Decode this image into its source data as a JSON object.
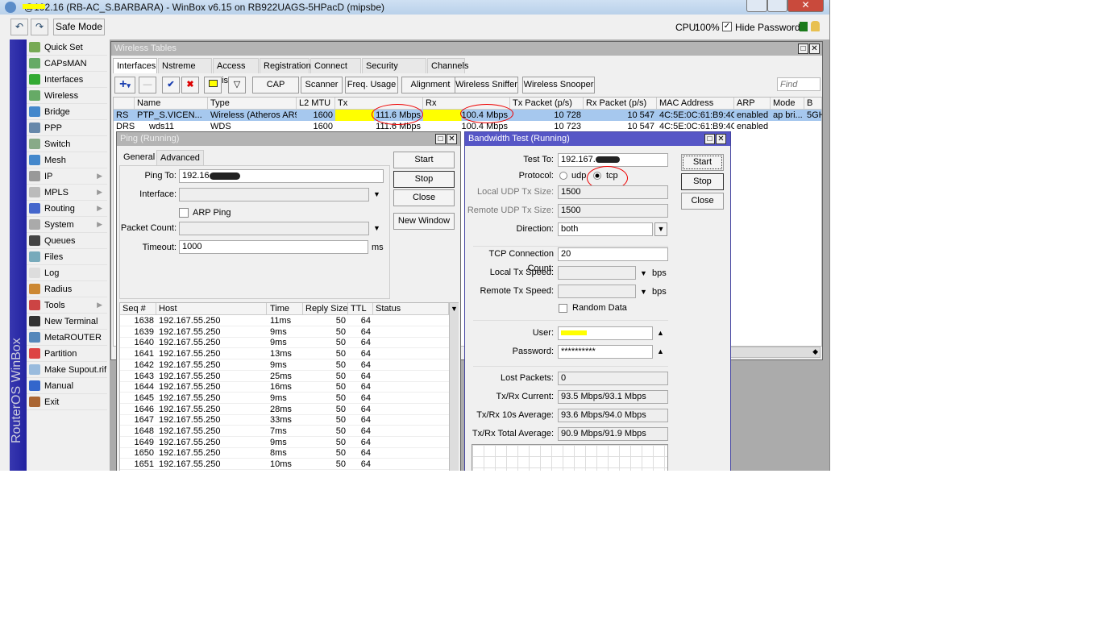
{
  "window": {
    "title": "@192.16 (RB-AC_S.BARBARA) - WinBox v6.15 on RB922UAGS-5HPacD (mipsbe)"
  },
  "toolbar": {
    "undo_icon": "undo-icon",
    "redo_icon": "redo-icon",
    "safe_mode": "Safe Mode",
    "cpu_label": "CPU:",
    "cpu_value": "100%",
    "hide_passwords": "Hide Passwords",
    "hide_passwords_checked": true
  },
  "sidebar": {
    "brand": "RouterOS WinBox",
    "items": [
      {
        "label": "Quick Set",
        "icon": "wand-icon",
        "color": "#7a5"
      },
      {
        "label": "CAPsMAN",
        "icon": "antenna-icon",
        "color": "#6a6"
      },
      {
        "label": "Interfaces",
        "icon": "interfaces-icon",
        "color": "#3a3"
      },
      {
        "label": "Wireless",
        "icon": "antenna-icon",
        "color": "#6a6"
      },
      {
        "label": "Bridge",
        "icon": "bridge-icon",
        "color": "#48c"
      },
      {
        "label": "PPP",
        "icon": "ppp-icon",
        "color": "#68a"
      },
      {
        "label": "Switch",
        "icon": "switch-icon",
        "color": "#8a8"
      },
      {
        "label": "Mesh",
        "icon": "mesh-icon",
        "color": "#48c"
      },
      {
        "label": "IP",
        "icon": "ip-icon",
        "color": "#999",
        "sub": true
      },
      {
        "label": "MPLS",
        "icon": "mpls-icon",
        "color": "#bbb",
        "sub": true
      },
      {
        "label": "Routing",
        "icon": "routing-icon",
        "color": "#46c",
        "sub": true
      },
      {
        "label": "System",
        "icon": "gear-icon",
        "color": "#aaa",
        "sub": true
      },
      {
        "label": "Queues",
        "icon": "queues-icon",
        "color": "#444"
      },
      {
        "label": "Files",
        "icon": "folder-icon",
        "color": "#7ab"
      },
      {
        "label": "Log",
        "icon": "log-icon",
        "color": "#ddd"
      },
      {
        "label": "Radius",
        "icon": "users-icon",
        "color": "#c83"
      },
      {
        "label": "Tools",
        "icon": "tools-icon",
        "color": "#c44",
        "sub": true
      },
      {
        "label": "New Terminal",
        "icon": "terminal-icon",
        "color": "#333"
      },
      {
        "label": "MetaROUTER",
        "icon": "metarouter-icon",
        "color": "#58b"
      },
      {
        "label": "Partition",
        "icon": "pie-icon",
        "color": "#d44"
      },
      {
        "label": "Make Supout.rif",
        "icon": "file-icon",
        "color": "#9bd"
      },
      {
        "label": "Manual",
        "icon": "help-icon",
        "color": "#36c"
      },
      {
        "label": "Exit",
        "icon": "exit-icon",
        "color": "#a63"
      }
    ]
  },
  "wireless": {
    "title": "Wireless Tables",
    "tabs": [
      "Interfaces",
      "Nstreme Dual",
      "Access List",
      "Registration",
      "Connect List",
      "Security Profiles",
      "Channels"
    ],
    "buttons": [
      "CAP",
      "Scanner",
      "Freq. Usage",
      "Alignment",
      "Wireless Sniffer",
      "Wireless Snooper"
    ],
    "find_placeholder": "Find",
    "columns": [
      "",
      "Name",
      "Type",
      "L2 MTU",
      "Tx",
      "Rx",
      "Tx Packet (p/s)",
      "Rx Packet (p/s)",
      "MAC Address",
      "ARP",
      "Mode",
      "B"
    ],
    "rows": [
      {
        "flags": "RS",
        "name": "PTP_S.VICEN...",
        "type": "Wireless (Atheros AR9...",
        "mtu": "1600",
        "tx": "111.6 Mbps",
        "rx": "100.4 Mbps",
        "txp": "10 728",
        "rxp": "10 547",
        "mac": "4C:5E:0C:61:B9:4C",
        "arp": "enabled",
        "mode": "ap bri...",
        "band": "5GH",
        "selected": true
      },
      {
        "flags": "DRS",
        "name": "wds11",
        "type": "WDS",
        "mtu": "1600",
        "tx": "111.6 Mbps",
        "rx": "100.4 Mbps",
        "txp": "10 723",
        "rxp": "10 547",
        "mac": "4C:5E:0C:61:B9:4C",
        "arp": "enabled",
        "mode": "",
        "band": "",
        "selected": false
      }
    ]
  },
  "ping": {
    "title": "Ping (Running)",
    "tabs": [
      "General",
      "Advanced"
    ],
    "ping_to_label": "Ping To:",
    "ping_to": "192.16",
    "interface_label": "Interface:",
    "interface": "",
    "arp_ping": "ARP Ping",
    "packet_count_label": "Packet Count:",
    "packet_count": "",
    "timeout_label": "Timeout:",
    "timeout": "1000",
    "timeout_unit": "ms",
    "buttons": {
      "start": "Start",
      "stop": "Stop",
      "close": "Close",
      "new_window": "New Window"
    },
    "columns": [
      "Seq #",
      "Host",
      "Time",
      "Reply Size",
      "TTL",
      "Status"
    ],
    "rows": [
      [
        "1638",
        "192.167.55.250",
        "11ms",
        "50",
        "64",
        ""
      ],
      [
        "1639",
        "192.167.55.250",
        "9ms",
        "50",
        "64",
        ""
      ],
      [
        "1640",
        "192.167.55.250",
        "9ms",
        "50",
        "64",
        ""
      ],
      [
        "1641",
        "192.167.55.250",
        "13ms",
        "50",
        "64",
        ""
      ],
      [
        "1642",
        "192.167.55.250",
        "9ms",
        "50",
        "64",
        ""
      ],
      [
        "1643",
        "192.167.55.250",
        "25ms",
        "50",
        "64",
        ""
      ],
      [
        "1644",
        "192.167.55.250",
        "16ms",
        "50",
        "64",
        ""
      ],
      [
        "1645",
        "192.167.55.250",
        "9ms",
        "50",
        "64",
        ""
      ],
      [
        "1646",
        "192.167.55.250",
        "28ms",
        "50",
        "64",
        ""
      ],
      [
        "1647",
        "192.167.55.250",
        "33ms",
        "50",
        "64",
        ""
      ],
      [
        "1648",
        "192.167.55.250",
        "7ms",
        "50",
        "64",
        ""
      ],
      [
        "1649",
        "192.167.55.250",
        "9ms",
        "50",
        "64",
        ""
      ],
      [
        "1650",
        "192.167.55.250",
        "8ms",
        "50",
        "64",
        ""
      ],
      [
        "1651",
        "192.167.55.250",
        "10ms",
        "50",
        "64",
        ""
      ]
    ]
  },
  "btest": {
    "title": "Bandwidth Test (Running)",
    "test_to_label": "Test To:",
    "test_to": "192.167.",
    "protocol_label": "Protocol:",
    "protocol_options": [
      "udp",
      "tcp"
    ],
    "protocol": "tcp",
    "local_udp_label": "Local UDP Tx Size:",
    "local_udp": "1500",
    "remote_udp_label": "Remote UDP Tx Size:",
    "remote_udp": "1500",
    "direction_label": "Direction:",
    "direction": "both",
    "tcp_count_label": "TCP Connection Count:",
    "tcp_count": "20",
    "local_speed_label": "Local Tx Speed:",
    "remote_speed_label": "Remote Tx Speed:",
    "speed_unit": "bps",
    "random_data": "Random Data",
    "user_label": "User:",
    "password_label": "Password:",
    "password": "**********",
    "lost_label": "Lost Packets:",
    "lost": "0",
    "current_label": "Tx/Rx Current:",
    "current": "93.5 Mbps/93.1 Mbps",
    "avg10_label": "Tx/Rx 10s Average:",
    "avg10": "93.6 Mbps/94.0 Mbps",
    "total_label": "Tx/Rx Total Average:",
    "total": "90.9 Mbps/91.9 Mbps",
    "buttons": {
      "start": "Start",
      "stop": "Stop",
      "close": "Close"
    }
  },
  "colors": {
    "selected_row": "#a6c8ee",
    "traffic_bar": "#ffff00",
    "annotation": "#e00000",
    "btest_title": "#5656c6",
    "sidebar_strip": "#2a2aa6"
  }
}
